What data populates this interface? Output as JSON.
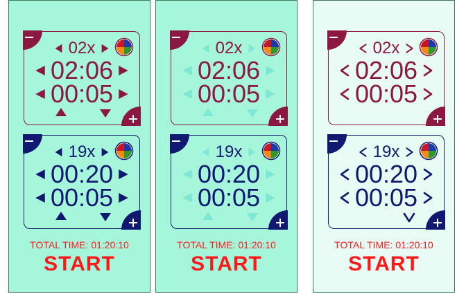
{
  "colors": {
    "panel1_bg": "#a6f6dc",
    "panel2_bg": "#a6f6dc",
    "panel3_bg": "#e8fbf4",
    "top_accent": "#8a1840",
    "bottom_accent": "#101870",
    "disabled_arrow": "#7ee8d4",
    "total_text": "#ff1a1a",
    "start_text": "#ff1a1a"
  },
  "panels": [
    {
      "top_timer": {
        "reps": "02x",
        "work": "02:06",
        "rest": "00:05"
      },
      "bottom_timer": {
        "reps": "19x",
        "work": "00:20",
        "rest": "00:05"
      },
      "total_time": "TOTAL TIME: 01:20:10",
      "start_label": "START"
    },
    {
      "top_timer": {
        "reps": "02x",
        "work": "02:06",
        "rest": "00:05"
      },
      "bottom_timer": {
        "reps": "19x",
        "work": "00:20",
        "rest": "00:05"
      },
      "total_time": "TOTAL TIME: 01:20:10",
      "start_label": "START"
    },
    {
      "top_timer": {
        "reps": "02x",
        "work": "02:06",
        "rest": "00:05"
      },
      "bottom_timer": {
        "reps": "19x",
        "work": "00:20",
        "rest": "00:05"
      },
      "total_time": "TOTAL TIME: 01:20:10",
      "start_label": "START"
    }
  ],
  "icons": {
    "remove": "minus-icon",
    "add": "plus-icon",
    "color": "color-pie-icon",
    "left": "left-arrow-icon",
    "right": "right-arrow-icon",
    "up": "up-arrow-icon",
    "down": "down-arrow-icon",
    "chevron_down": "chevron-down-icon"
  }
}
